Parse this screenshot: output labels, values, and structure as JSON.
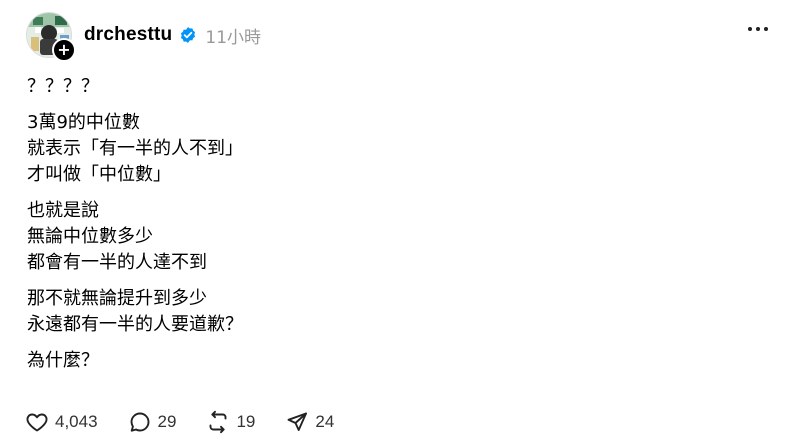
{
  "post": {
    "username": "drchesttu",
    "time": "11小時",
    "paragraphs": [
      [
        "？？？？"
      ],
      [
        "3萬9的中位數",
        "就表示「有一半的人不到」",
        "才叫做「中位數」"
      ],
      [
        "也就是說",
        "無論中位數多少",
        "都會有一半的人達不到"
      ],
      [
        "那不就無論提升到多少",
        "永遠都有一半的人要道歉？"
      ],
      [
        "為什麼？"
      ]
    ]
  },
  "actions": {
    "likes": "4,043",
    "comments": "29",
    "reposts": "19",
    "shares": "24"
  },
  "colors": {
    "verified": "#0095f6",
    "muted": "#999999",
    "text": "#000000"
  },
  "icons": [
    "avatar",
    "follow-plus-icon",
    "verified-badge-icon",
    "more-icon",
    "heart-icon",
    "comment-icon",
    "repost-icon",
    "share-icon"
  ]
}
